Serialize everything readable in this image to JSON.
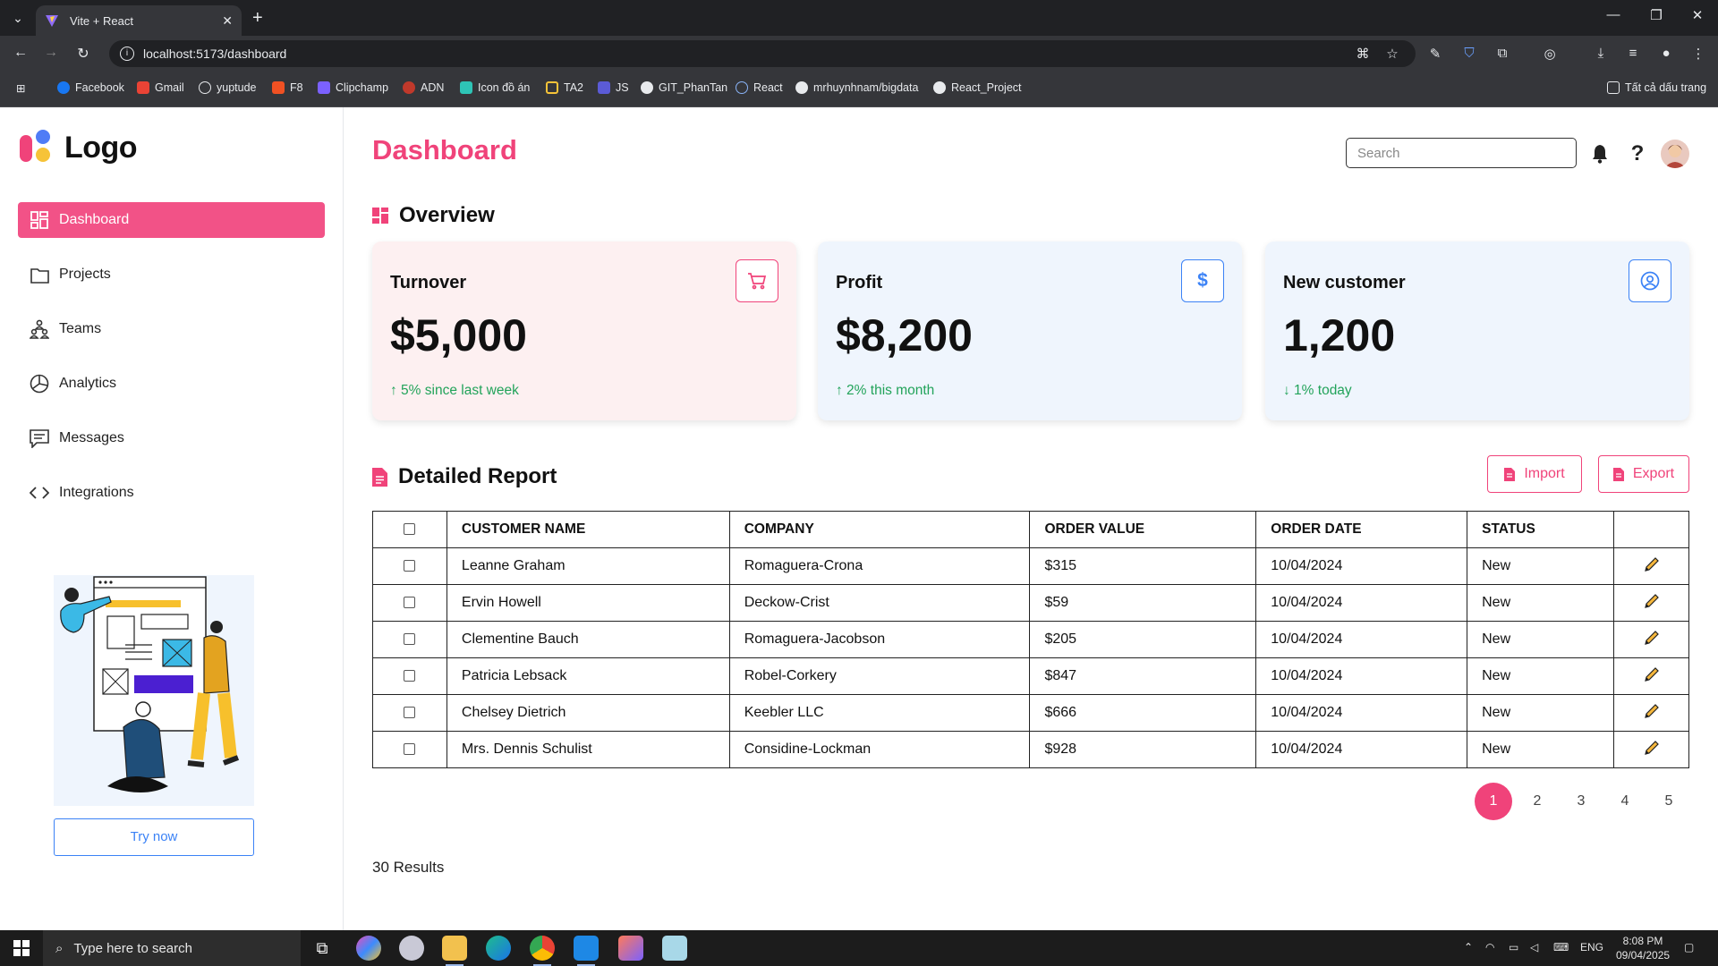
{
  "browser": {
    "tab_title": "Vite + React",
    "url": "localhost:5173/dashboard",
    "bookmarks": [
      "Facebook",
      "Gmail",
      "yuptude",
      "F8",
      "Clipchamp",
      "ADN",
      "Icon đồ án",
      "TA2",
      "JS",
      "GIT_PhanTan",
      "React",
      "mrhuynhnam/bigdata",
      "React_Project"
    ],
    "all_bookmarks": "Tất cả dấu trang"
  },
  "sidebar": {
    "logo": "Logo",
    "items": [
      {
        "label": "Dashboard",
        "icon": "dashboard-icon"
      },
      {
        "label": "Projects",
        "icon": "folder-icon"
      },
      {
        "label": "Teams",
        "icon": "teams-icon"
      },
      {
        "label": "Analytics",
        "icon": "pie-chart-icon"
      },
      {
        "label": "Messages",
        "icon": "message-icon"
      },
      {
        "label": "Integrations",
        "icon": "code-icon"
      }
    ],
    "promo_button": "Try now"
  },
  "header": {
    "title": "Dashboard",
    "search_placeholder": "Search"
  },
  "overview": {
    "title": "Overview",
    "cards": [
      {
        "label": "Turnover",
        "value": "$5,000",
        "change": "↑ 5% since last week",
        "icon": "cart-icon",
        "bg": "#fdf0f1",
        "accent": "#f0437a"
      },
      {
        "label": "Profit",
        "value": "$8,200",
        "change": "↑ 2% this month",
        "icon": "dollar-icon",
        "bg": "#eff5fd",
        "accent": "#3b82f6"
      },
      {
        "label": "New customer",
        "value": "1,200",
        "change": "↓ 1% today",
        "icon": "user-circle-icon",
        "bg": "#eff5fd",
        "accent": "#3b82f6"
      }
    ]
  },
  "report": {
    "title": "Detailed Report",
    "import_label": "Import",
    "export_label": "Export",
    "columns": [
      "CUSTOMER NAME",
      "COMPANY",
      "ORDER VALUE",
      "ORDER DATE",
      "STATUS"
    ],
    "rows": [
      {
        "name": "Leanne Graham",
        "company": "Romaguera-Crona",
        "value": "$315",
        "date": "10/04/2024",
        "status": "New"
      },
      {
        "name": "Ervin Howell",
        "company": "Deckow-Crist",
        "value": "$59",
        "date": "10/04/2024",
        "status": "New"
      },
      {
        "name": "Clementine Bauch",
        "company": "Romaguera-Jacobson",
        "value": "$205",
        "date": "10/04/2024",
        "status": "New"
      },
      {
        "name": "Patricia Lebsack",
        "company": "Robel-Corkery",
        "value": "$847",
        "date": "10/04/2024",
        "status": "New"
      },
      {
        "name": "Chelsey Dietrich",
        "company": "Keebler LLC",
        "value": "$666",
        "date": "10/04/2024",
        "status": "New"
      },
      {
        "name": "Mrs. Dennis Schulist",
        "company": "Considine-Lockman",
        "value": "$928",
        "date": "10/04/2024",
        "status": "New"
      }
    ],
    "pages": [
      "1",
      "2",
      "3",
      "4",
      "5"
    ],
    "current_page": "1",
    "results": "30 Results"
  },
  "taskbar": {
    "search_placeholder": "Type here to search",
    "lang": "ENG",
    "time": "8:08 PM",
    "date": "09/04/2025"
  },
  "colors": {
    "accent": "#f0437a",
    "blue": "#3b82f6",
    "success": "#22a35a"
  }
}
